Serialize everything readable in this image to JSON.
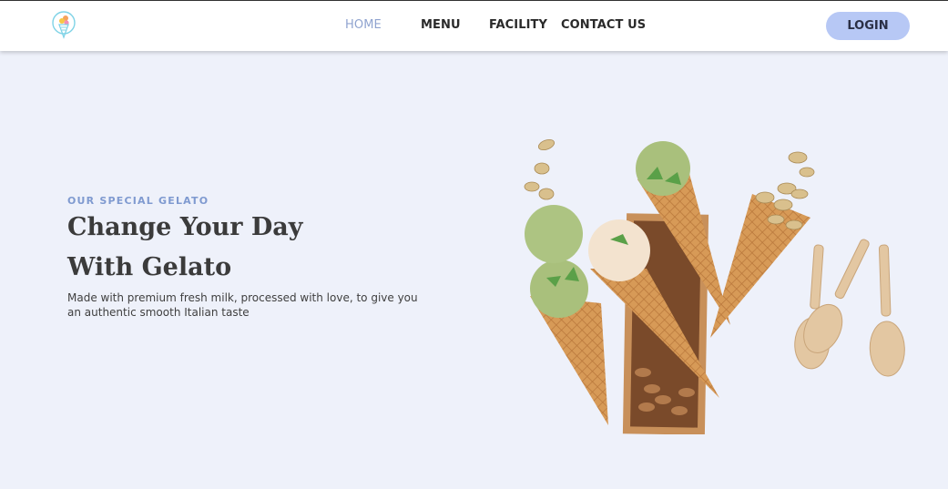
{
  "nav": {
    "logo_icon": "ice-cream-cone-icon",
    "links": [
      {
        "label": "HOME",
        "active": true
      },
      {
        "label": "MENU",
        "active": false
      },
      {
        "label": "FACILITY",
        "active": false
      },
      {
        "label": "CONTACT US",
        "active": false
      }
    ],
    "login_label": "LOGIN"
  },
  "hero": {
    "eyebrow": "OUR SPECIAL GELATO",
    "title_line1": "Change Your Day",
    "title_line2": "With Gelato",
    "description": "Made with premium fresh milk, processed with love, to give you an authentic smooth Italian taste",
    "image_subject": "gelato-cones-with-pistachios-almonds-and-wooden-spoons"
  },
  "colors": {
    "background": "#eef1fa",
    "navbar": "#ffffff",
    "accent": "#8fa3cf",
    "eyebrow": "#7f9ad0",
    "login_button": "#b7c8f5",
    "heading": "#3b3b3b"
  }
}
